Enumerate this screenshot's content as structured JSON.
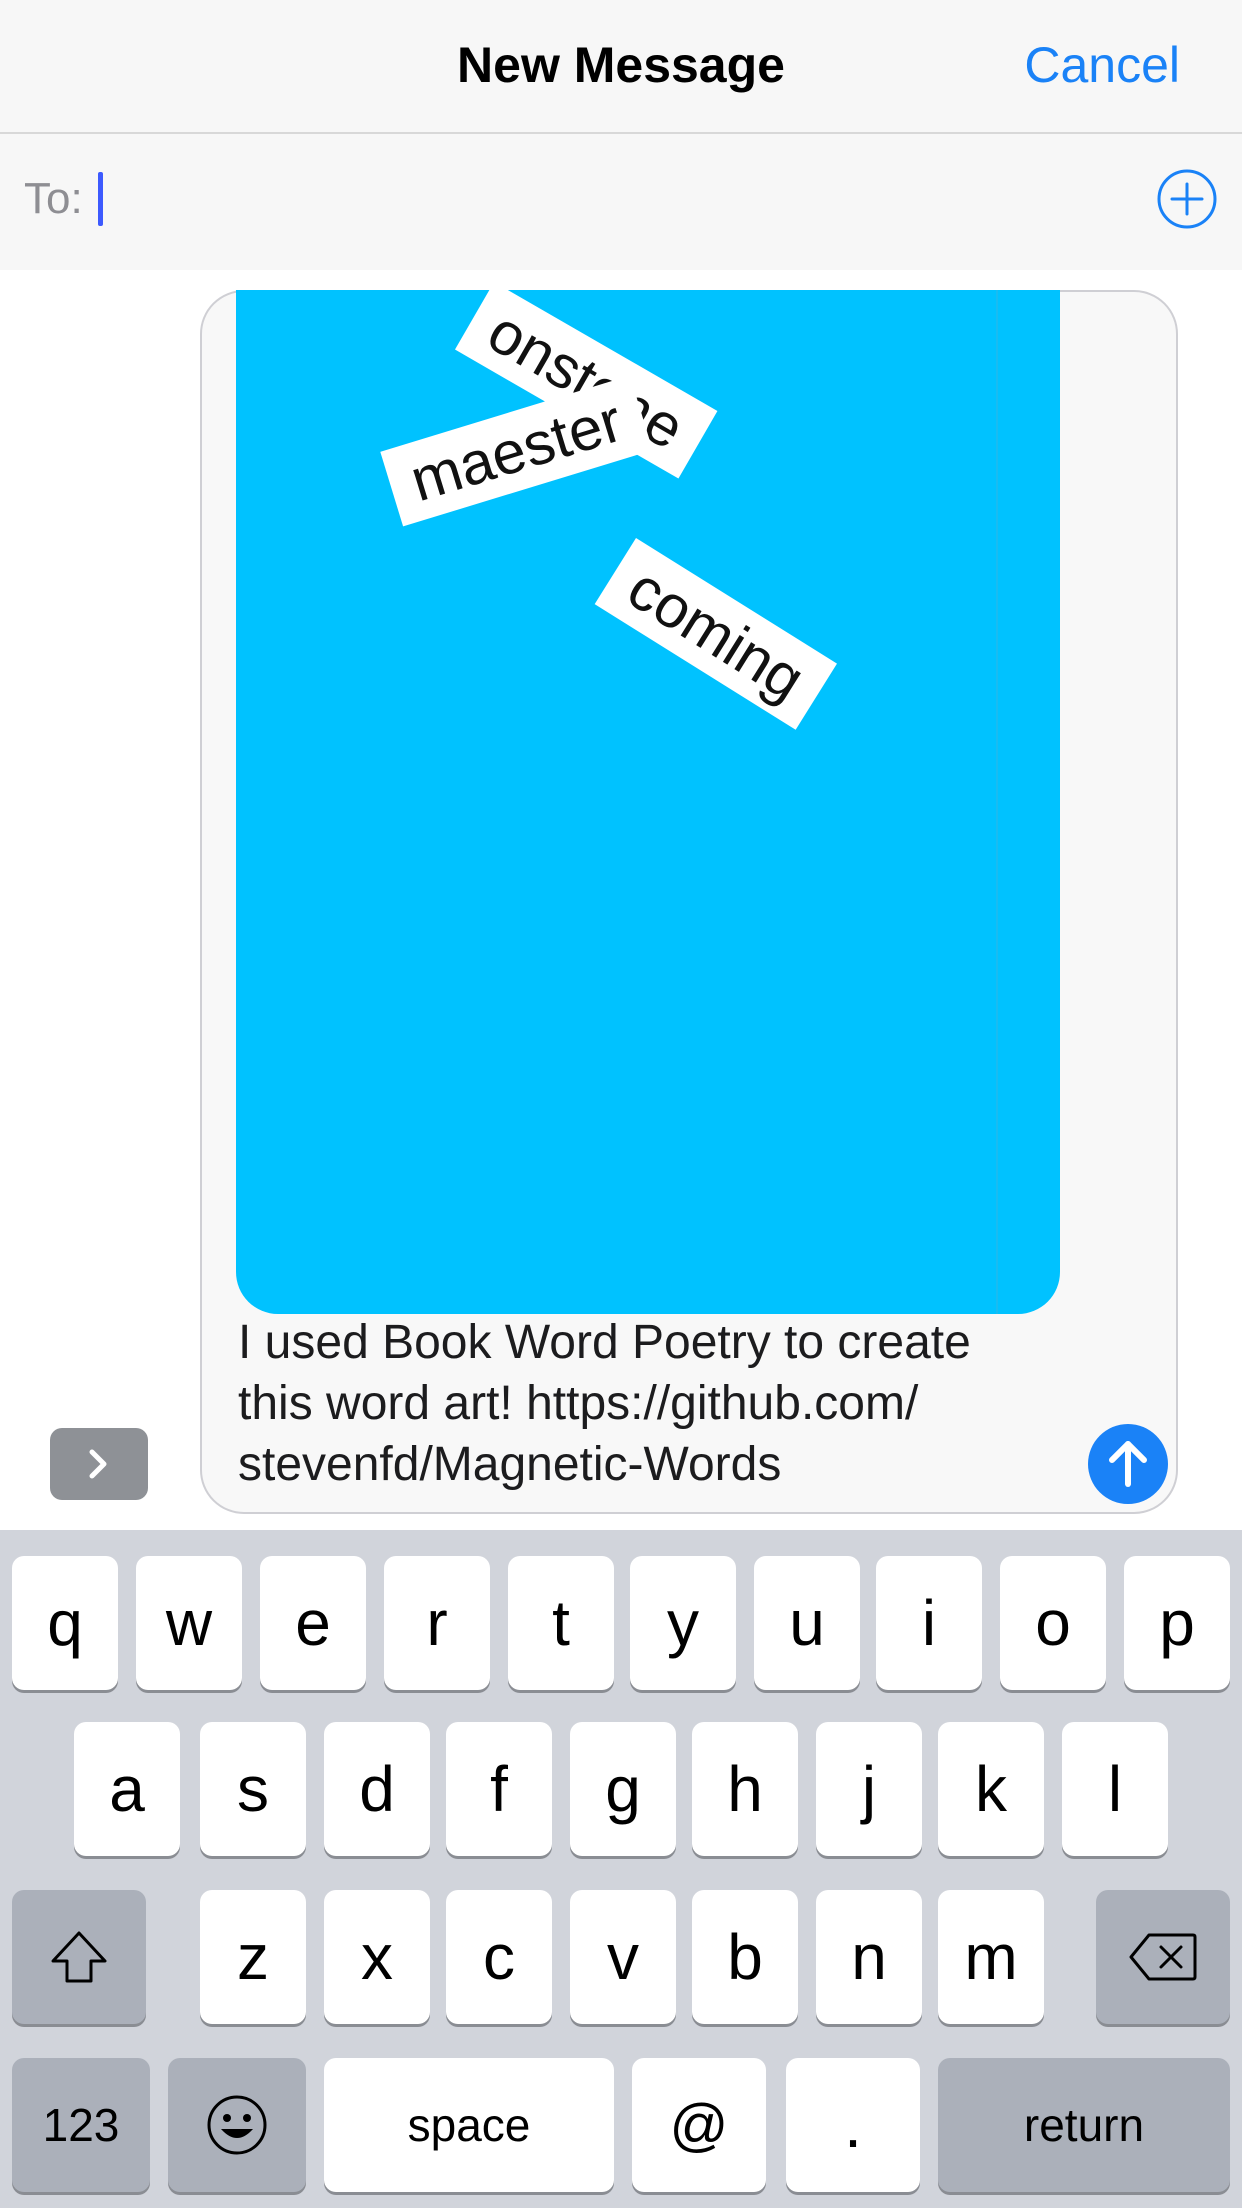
{
  "header": {
    "title": "New Message",
    "cancel_label": "Cancel"
  },
  "recipient": {
    "label": "To:",
    "value": ""
  },
  "art": {
    "background_color": "#00c2ff",
    "words": [
      "onstone",
      "maester",
      "coming"
    ]
  },
  "message": {
    "lines": [
      "I used Book Word Poetry to create",
      "this word art! https://github.com/",
      "stevenfd/Magnetic-Words"
    ]
  },
  "icons": {
    "add_contact": "plus-circle-icon",
    "send": "arrow-up-icon",
    "expand": "chevron-right-icon",
    "shift": "shift-icon",
    "backspace": "backspace-icon",
    "emoji": "emoji-icon"
  },
  "keyboard": {
    "row1": [
      "q",
      "w",
      "e",
      "r",
      "t",
      "y",
      "u",
      "i",
      "o",
      "p"
    ],
    "row2": [
      "a",
      "s",
      "d",
      "f",
      "g",
      "h",
      "j",
      "k",
      "l"
    ],
    "row3": [
      "z",
      "x",
      "c",
      "v",
      "b",
      "n",
      "m"
    ],
    "numbers_label": "123",
    "space_label": "space",
    "at_label": "@",
    "period_label": ".",
    "return_label": "return"
  }
}
